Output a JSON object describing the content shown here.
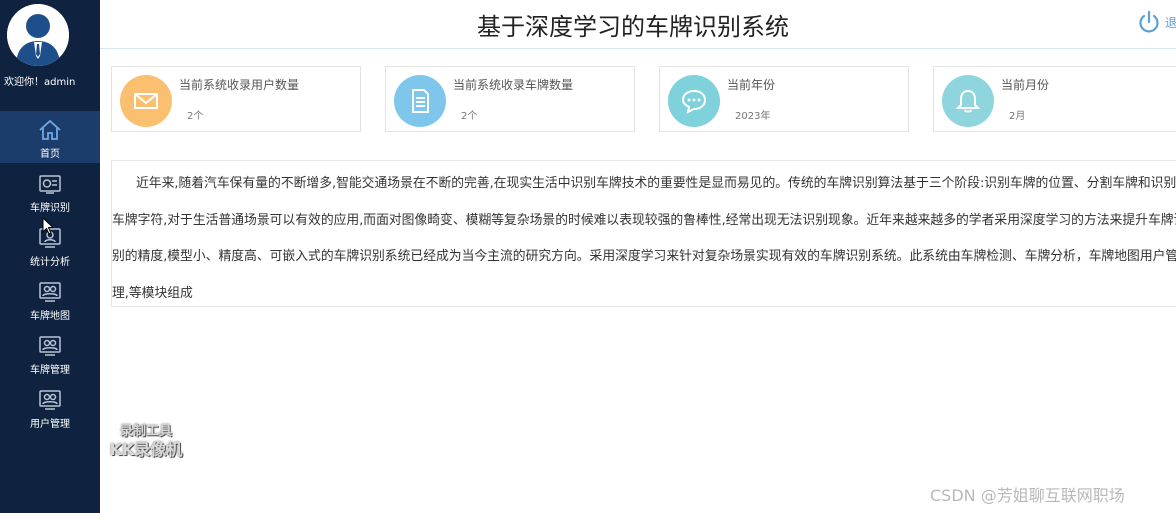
{
  "header": {
    "title": "基于深度学习的车牌识别系统",
    "logout_label": "退"
  },
  "sidebar": {
    "welcome": "欢迎你！admin",
    "items": [
      {
        "label": "首页",
        "icon": "home-icon",
        "active": true
      },
      {
        "label": "车牌识别",
        "icon": "plate-recognition-icon"
      },
      {
        "label": "统计分析",
        "icon": "statistics-icon"
      },
      {
        "label": "车牌地图",
        "icon": "plate-map-icon"
      },
      {
        "label": "车牌管理",
        "icon": "plate-manage-icon"
      },
      {
        "label": "用户管理",
        "icon": "user-manage-icon"
      }
    ]
  },
  "stats": [
    {
      "title": "当前系统收录用户数量",
      "value": "2个",
      "icon": "mail-icon",
      "color": "#fbbf70"
    },
    {
      "title": "当前系统收录车牌数量",
      "value": "2个",
      "icon": "document-icon",
      "color": "#7ec6ec"
    },
    {
      "title": "当前年份",
      "value": "2023年",
      "icon": "chat-icon",
      "color": "#7fd2dc"
    },
    {
      "title": "当前月份",
      "value": "2月",
      "icon": "bell-icon",
      "color": "#8ed5dd"
    }
  ],
  "intro": {
    "text": "近年来,随着汽车保有量的不断增多,智能交通场景在不断的完善,在现实生活中识别车牌技术的重要性是显而易见的。传统的车牌识别算法基于三个阶段:识别车牌的位置、分割车牌和识别车牌字符,对于生活普通场景可以有效的应用,而面对图像畸变、模糊等复杂场景的时候难以表现较强的鲁棒性,经常出现无法识别现象。近年来越来越多的学者采用深度学习的方法来提升车牌识别的精度,模型小、精度高、可嵌入式的车牌识别系统已经成为当今主流的研究方向。采用深度学习来针对复杂场景实现有效的车牌识别系统。此系统由车牌检测、车牌分析，车牌地图用户管理,等模块组成"
  },
  "overlays": {
    "recorder_line1": "录制工具",
    "recorder_line2": "KK录像机",
    "csdn": "CSDN @芳姐聊互联网职场"
  },
  "colors": {
    "sidebar_bg": "#0f2340",
    "sidebar_active": "#1c3d6b",
    "accent": "#5aa0d8"
  }
}
